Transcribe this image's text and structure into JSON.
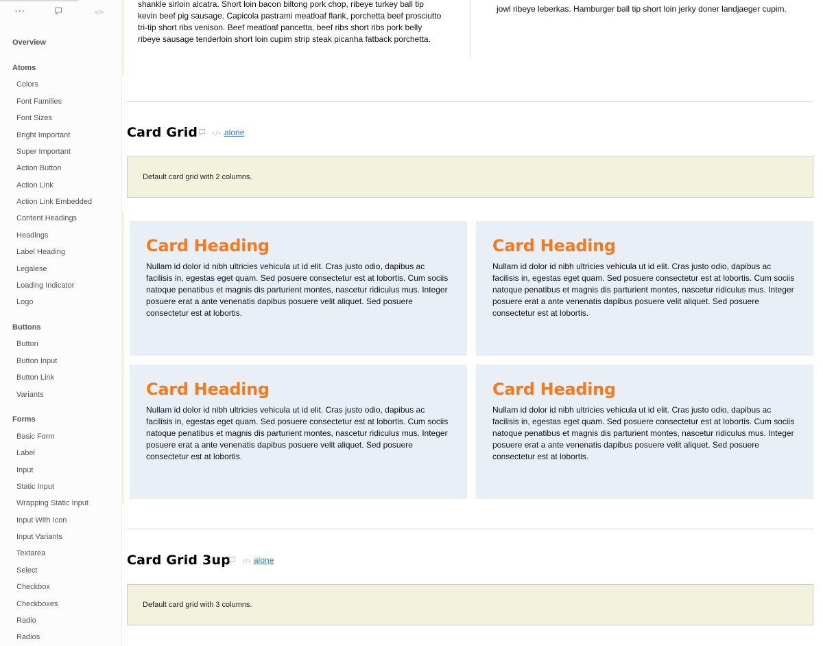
{
  "sidebar": {
    "toolbar": {
      "more": "···",
      "notes_icon": "comment-icon",
      "code_icon": "code-icon"
    },
    "overview": "Overview",
    "groups": [
      {
        "label": "Atoms",
        "items": [
          "Colors",
          "Font Families",
          "Font Sizes",
          "Bright Important",
          "Super Important",
          "Action Button",
          "Action Link",
          "Action Link Embedded",
          "Content Headings",
          "Headings",
          "Label Heading",
          "Legalese",
          "Loading Indicator",
          "Logo"
        ]
      },
      {
        "label": "Buttons",
        "items": [
          "Button",
          "Button Input",
          "Button Link",
          "Variants"
        ]
      },
      {
        "label": "Forms",
        "items": [
          "Basic Form",
          "Label",
          "Input",
          "Static Input",
          "Wrapping Static Input",
          "Input With Icon",
          "Input Variants",
          "Textarea",
          "Select",
          "Checkbox",
          "Checkboxes",
          "Radio",
          "Radios"
        ]
      }
    ]
  },
  "top": {
    "left_text": "shankle sirloin alcatra. Short loin bacon biltong pork chop, ribeye turkey ball tip kevin beef pig sausage. Capicola pastrami meatloaf flank, porchetta beef prosciutto tri-tip short ribs venison. Beef meatloaf pancetta, beef ribs short ribs pork belly ribeye sausage tenderloin short loin cupim strip steak picanha fatback porchetta.",
    "right_text": "jowl ribeye leberkas. Hamburger ball tip short loin jerky doner landjaeger cupim."
  },
  "sections": [
    {
      "title": "Card Grid",
      "link": "alone",
      "description": "Default card grid with 2 columns.",
      "cards": [
        {
          "heading": "Card Heading",
          "body": "Nullam id dolor id nibh ultricies vehicula ut id elit. Cras justo odio, dapibus ac facilisis in, egestas eget quam. Sed posuere consectetur est at lobortis. Cum sociis natoque penatibus et magnis dis parturient montes, nascetur ridiculus mus. Integer posuere erat a ante venenatis dapibus posuere velit aliquet. Sed posuere consectetur est at lobortis."
        },
        {
          "heading": "Card Heading",
          "body": "Nullam id dolor id nibh ultricies vehicula ut id elit. Cras justo odio, dapibus ac facilisis in, egestas eget quam. Sed posuere consectetur est at lobortis. Cum sociis natoque penatibus et magnis dis parturient montes, nascetur ridiculus mus. Integer posuere erat a ante venenatis dapibus posuere velit aliquet. Sed posuere consectetur est at lobortis."
        },
        {
          "heading": "Card Heading",
          "body": "Nullam id dolor id nibh ultricies vehicula ut id elit. Cras justo odio, dapibus ac facilisis in, egestas eget quam. Sed posuere consectetur est at lobortis. Cum sociis natoque penatibus et magnis dis parturient montes, nascetur ridiculus mus. Integer posuere erat a ante venenatis dapibus posuere velit aliquet. Sed posuere consectetur est at lobortis."
        },
        {
          "heading": "Card Heading",
          "body": "Nullam id dolor id nibh ultricies vehicula ut id elit. Cras justo odio, dapibus ac facilisis in, egestas eget quam. Sed posuere consectetur est at lobortis. Cum sociis natoque penatibus et magnis dis parturient montes, nascetur ridiculus mus. Integer posuere erat a ante venenatis dapibus posuere velit aliquet. Sed posuere consectetur est at lobortis."
        }
      ]
    },
    {
      "title": "Card Grid 3up",
      "link": "alone",
      "description": "Default card grid with 3 columns."
    }
  ],
  "icons": {
    "comment": "comment-icon",
    "code": "code-icon"
  },
  "colors": {
    "accent": "#f37a1f",
    "link": "#2a7bd5",
    "card_bg": "#e8eff7",
    "desc_bg": "#f3f3dd"
  }
}
